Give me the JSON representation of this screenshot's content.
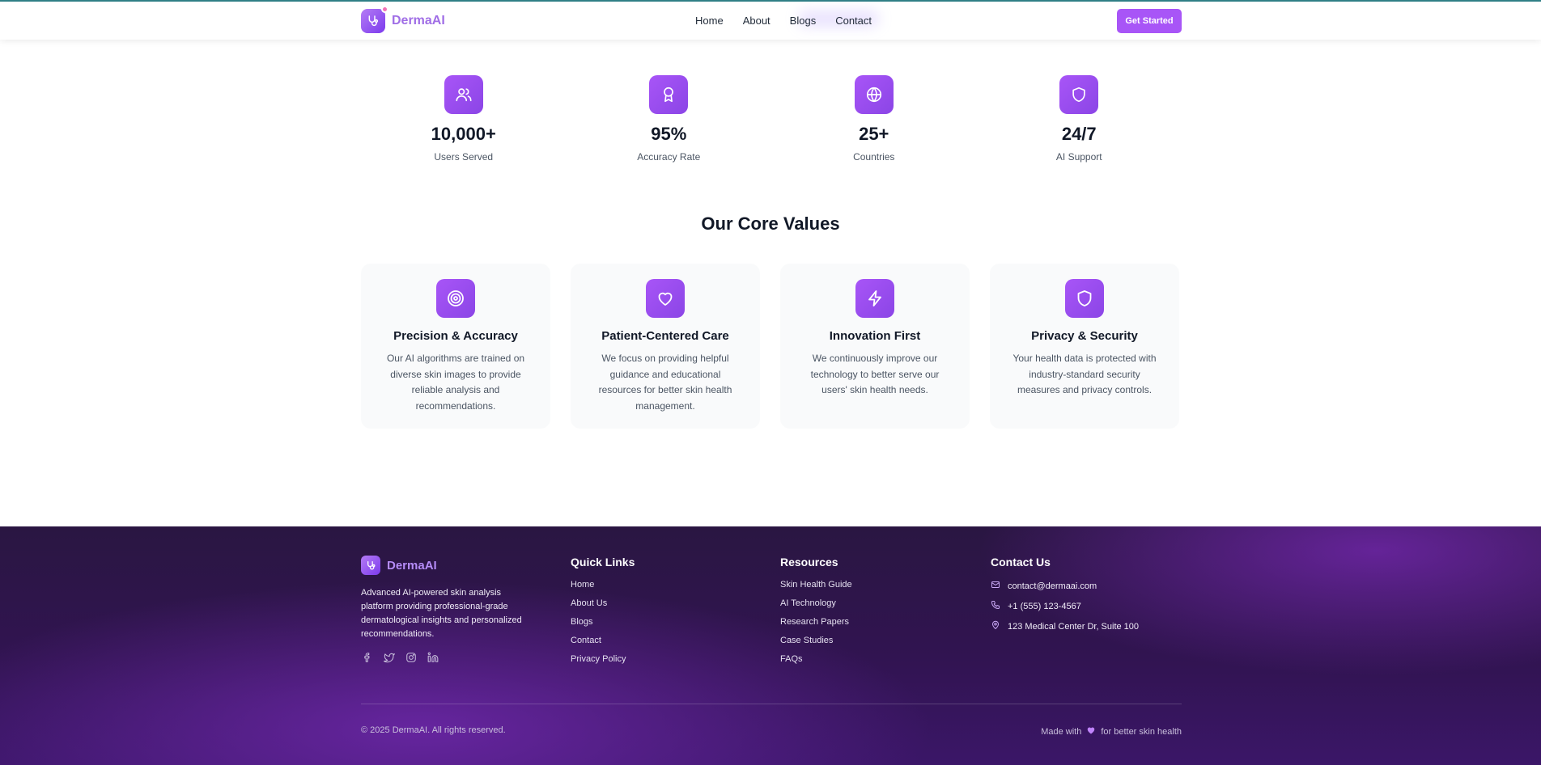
{
  "header": {
    "brand": "DermaAI",
    "nav": [
      "Home",
      "About",
      "Blogs",
      "Contact"
    ],
    "cta": "Get Started"
  },
  "stats": [
    {
      "value": "10,000+",
      "label": "Users Served",
      "icon": "users-icon"
    },
    {
      "value": "95%",
      "label": "Accuracy Rate",
      "icon": "award-icon"
    },
    {
      "value": "25+",
      "label": "Countries",
      "icon": "globe-icon"
    },
    {
      "value": "24/7",
      "label": "AI Support",
      "icon": "shield-icon"
    }
  ],
  "values": {
    "title": "Our Core Values",
    "cards": [
      {
        "title": "Precision & Accuracy",
        "text": "Our AI algorithms are trained on diverse skin images to provide reliable analysis and recommendations.",
        "icon": "target-icon"
      },
      {
        "title": "Patient-Centered Care",
        "text": "We focus on providing helpful guidance and educational resources for better skin health management.",
        "icon": "heart-icon"
      },
      {
        "title": "Innovation First",
        "text": "We continuously improve our technology to better serve our users' skin health needs.",
        "icon": "lightning-icon"
      },
      {
        "title": "Privacy & Security",
        "text": "Your health data is protected with industry-standard security measures and privacy controls.",
        "icon": "shield-icon"
      }
    ]
  },
  "footer": {
    "brand": "DermaAI",
    "description": "Advanced AI-powered skin analysis platform providing professional-grade dermatological insights and personalized recommendations.",
    "quick_links": {
      "title": "Quick Links",
      "items": [
        "Home",
        "About Us",
        "Blogs",
        "Contact",
        "Privacy Policy"
      ]
    },
    "resources": {
      "title": "Resources",
      "items": [
        "Skin Health Guide",
        "AI Technology",
        "Research Papers",
        "Case Studies",
        "FAQs"
      ]
    },
    "contact": {
      "title": "Contact Us",
      "email": "contact@dermaai.com",
      "phone": "+1 (555) 123-4567",
      "address": "123 Medical Center Dr, Suite 100"
    },
    "copyright": "© 2025 DermaAI. All rights reserved.",
    "made_prefix": "Made with",
    "made_suffix": "for better skin health"
  },
  "colors": {
    "accent": "#a855f7",
    "footer_bg": "#2a1642"
  }
}
